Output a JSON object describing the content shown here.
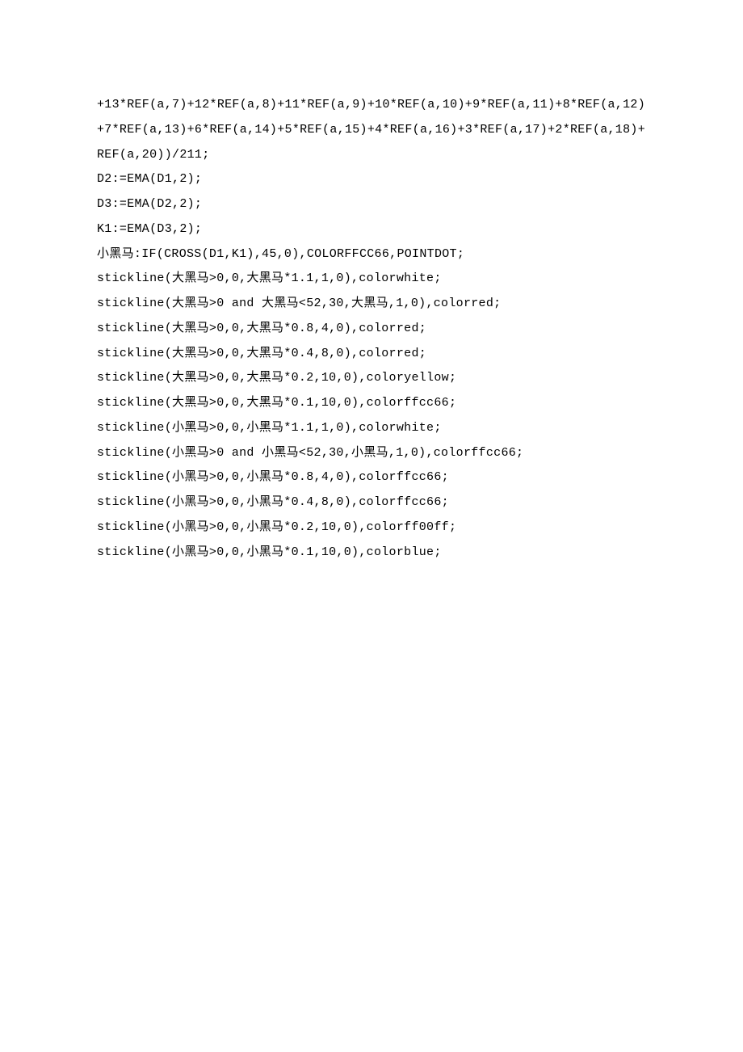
{
  "code": {
    "lines": [
      "+13*REF(a,7)+12*REF(a,8)+11*REF(a,9)+10*REF(a,10)+9*REF(a,11)+8*REF(a,12)",
      "+7*REF(a,13)+6*REF(a,14)+5*REF(a,15)+4*REF(a,16)+3*REF(a,17)+2*REF(a,18)+",
      "REF(a,20))/211;",
      "D2:=EMA(D1,2);",
      "D3:=EMA(D2,2);",
      "K1:=EMA(D3,2);",
      "小黑马:IF(CROSS(D1,K1),45,0),COLORFFCC66,POINTDOT;",
      "stickline(大黑马>0,0,大黑马*1.1,1,0),colorwhite;",
      "stickline(大黑马>0 and 大黑马<52,30,大黑马,1,0),colorred;",
      "stickline(大黑马>0,0,大黑马*0.8,4,0),colorred;",
      "stickline(大黑马>0,0,大黑马*0.4,8,0),colorred;",
      "stickline(大黑马>0,0,大黑马*0.2,10,0),coloryellow;",
      "stickline(大黑马>0,0,大黑马*0.1,10,0),colorffcc66;",
      "stickline(小黑马>0,0,小黑马*1.1,1,0),colorwhite;",
      "stickline(小黑马>0 and 小黑马<52,30,小黑马,1,0),colorffcc66;",
      "stickline(小黑马>0,0,小黑马*0.8,4,0),colorffcc66;",
      "stickline(小黑马>0,0,小黑马*0.4,8,0),colorffcc66;",
      "stickline(小黑马>0,0,小黑马*0.2,10,0),colorff00ff;",
      "stickline(小黑马>0,0,小黑马*0.1,10,0),colorblue;"
    ]
  }
}
